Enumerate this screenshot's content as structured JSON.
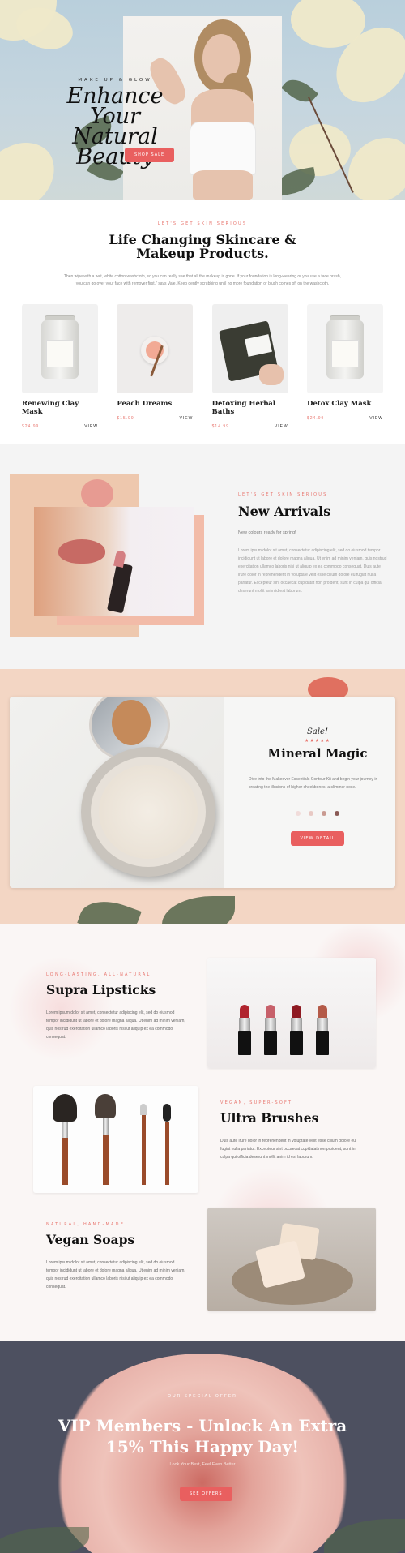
{
  "hero": {
    "kicker": "MAKE UP & GLOW",
    "title_line1": "Enhance Your",
    "title_line2": "Natural Beauty",
    "button": "SHOP SALE"
  },
  "skincare": {
    "kicker": "LET'S GET SKIN SERIOUS",
    "title": "Life Changing Skincare & Makeup Products.",
    "description": "Then wipe with a wet, white cotton washcloth, so you can really see that all the makeup is gone. If your foundation is long-wearing or you use a face brush, you can go over your face with remover first,\" says Vale. Keep gently scrubbing until no more foundation or blush comes off on the washcloth.",
    "products": [
      {
        "name": "Renewing Clay Mask",
        "price": "$24.99",
        "link": "VIEW"
      },
      {
        "name": "Peach Dreams",
        "price": "$15.99",
        "link": "VIEW"
      },
      {
        "name": "Detoxing Herbal Baths",
        "price": "$14.99",
        "link": "VIEW"
      },
      {
        "name": "Detox Clay Mask",
        "price": "$24.99",
        "link": "VIEW"
      }
    ]
  },
  "arrivals": {
    "kicker": "LET'S GET SKIN SERIOUS",
    "title": "New Arrivals",
    "subtitle": "New colours ready for spring!",
    "description": "Lorem ipsum dolor sit amet, consectetur adipiscing elit, sed do eiusmod tempor incididunt ut labore et dolore magna aliqua. Ut enim ad minim veniam, quis nostrud exercitation ullamco laboris nisi ut aliquip ex ea commodo consequat. Duis aute irure dolor in reprehenderit in voluptate velit esse cillum dolore eu fugiat nulla pariatur. Excepteur sint occaecat cupidatat non proident, sunt in culpa qui officia deserunt mollit anim id est laborum."
  },
  "mineral": {
    "tag": "Sale!",
    "stars": "★★★★★",
    "title": "Mineral Magic",
    "description": "Dive into the Makeover Essentials Contour Kit and begin your journey in creating the illusions of higher cheekbones, a slimmer nose.",
    "swatch_colors": [
      "#f1dcda",
      "#e8c9c4",
      "#c99a91",
      "#8a5a55"
    ],
    "button": "VIEW DETAIL"
  },
  "features": [
    {
      "kicker": "LONG-LASTING, ALL-NATURAL",
      "title": "Supra Lipsticks",
      "description": "Lorem ipsum dolor sit amet, consectetur adipiscing elit, sed do eiusmod tempor incididunt ut labore et dolore magna aliqua. Ut enim ad minim veniam, quis nostrud exercitation ullamco laboris nisi ut aliquip ex ea commodo consequat."
    },
    {
      "kicker": "VEGAN, SUPER-SOFT",
      "title": "Ultra Brushes",
      "description": "Duis aute irure dolor in reprehenderit in voluptate velit esse cillum dolore eu fugiat nulla pariatur. Excepteur sint occaecat cupidatat non proident, sunt in culpa qui officia deserunt mollit anim id est laborum."
    },
    {
      "kicker": "NATURAL, HAND-MADE",
      "title": "Vegan Soaps",
      "description": "Lorem ipsum dolor sit amet, consectetur adipiscing elit, sed do eiusmod tempor incididunt ut labore et dolore magna aliqua. Ut enim ad minim veniam, quis nostrud exercitation ullamco laboris nisi ut aliquip ex ea commodo consequat."
    }
  ],
  "vip": {
    "kicker": "OUR SPECIAL OFFER",
    "title": "VIP Members - Unlock An Extra 15% This Happy Day!",
    "subtitle": "Look Your Best, Feel Even Better",
    "button": "SEE OFFERS"
  }
}
